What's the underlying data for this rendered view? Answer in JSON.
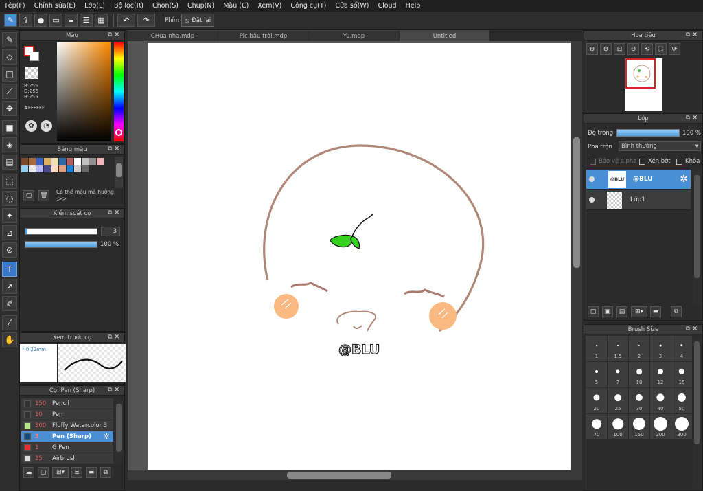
{
  "menu": [
    "Tệp(F)",
    "Chỉnh sửa(E)",
    "Lớp(L)",
    "Bộ lọc(R)",
    "Chọn(S)",
    "Chụp(N)",
    "Màu (C)",
    "Xem(V)",
    "Công cụ(T)",
    "Cửa sổ(W)",
    "Cloud",
    "Help"
  ],
  "toolbar": {
    "snap_label": "Phím",
    "reset_label": "Đặt lại"
  },
  "color_panel": {
    "title": "Màu",
    "r": "R:255",
    "g": "G:255",
    "b": "B:255",
    "hex": "#FFFFFF",
    "fg_color": "#ffffff",
    "hue_base": "#ff8a00"
  },
  "palette_panel": {
    "title": "Bảng màu",
    "note": "Có thể màu mà hường :>>",
    "colors": [
      "#7a4a2a",
      "#a86b3c",
      "#3a5fc4",
      "#e0b060",
      "#f0e0b0",
      "#2a6aa8",
      "#b06060",
      "#ffffff",
      "#c0c0c0",
      "#909090",
      "#f2b8b8",
      "#8fd0f0",
      "#e8e8e8",
      "#b4b4ff",
      "#4a4a8a",
      "#ffd8c0",
      "#e0a080",
      "#1a80d0",
      "#cfcfcf",
      "#6a6a6a"
    ]
  },
  "brush_control": {
    "title": "Kiểm soát cọ",
    "size": "3",
    "opacity": "100 %",
    "opacity_value": 100
  },
  "brush_preview": {
    "title": "Xem trước cọ",
    "size": "* 0.22mm"
  },
  "brush_list": {
    "title": "Cọ: Pen (Sharp)",
    "items": [
      {
        "size": "150",
        "name": "Pencil",
        "color": "#333333"
      },
      {
        "size": "10",
        "name": "Pen",
        "color": "#333333"
      },
      {
        "size": "300",
        "name": "Fluffy Watercolor 3",
        "color": "#b6e28a"
      },
      {
        "size": "3",
        "name": "Pen (Sharp)",
        "color": "#1b4a7a"
      },
      {
        "size": "1",
        "name": "G Pen",
        "color": "#e03030"
      },
      {
        "size": "25",
        "name": "Airbrush",
        "color": "#dddddd"
      }
    ]
  },
  "tabs": [
    "CHưa nha.mdp",
    "Pic bầu trời.mdp",
    "Yu.mdp",
    "Untitled"
  ],
  "canvas": {
    "watermark": "@BLU"
  },
  "navigator": {
    "title": "Hoa tiêu"
  },
  "layers": {
    "title": "Lớp",
    "opacity_label": "Độ trong",
    "opacity_value": "100 %",
    "blend_label": "Pha trộn",
    "blend_value": "Bình thường",
    "protect_alpha": "Bảo vệ alpha",
    "clipping": "Xén bớt",
    "lock": "Khóa",
    "items": [
      {
        "name": "@BLU",
        "thumb": "@BLU"
      },
      {
        "name": "Lớp1",
        "thumb": ""
      }
    ]
  },
  "brush_size": {
    "title": "Brush Size",
    "sizes": [
      "1",
      "1.5",
      "2",
      "3",
      "4",
      "5",
      "7",
      "10",
      "12",
      "15",
      "20",
      "25",
      "30",
      "40",
      "50",
      "70",
      "100",
      "150",
      "200",
      "300"
    ]
  }
}
